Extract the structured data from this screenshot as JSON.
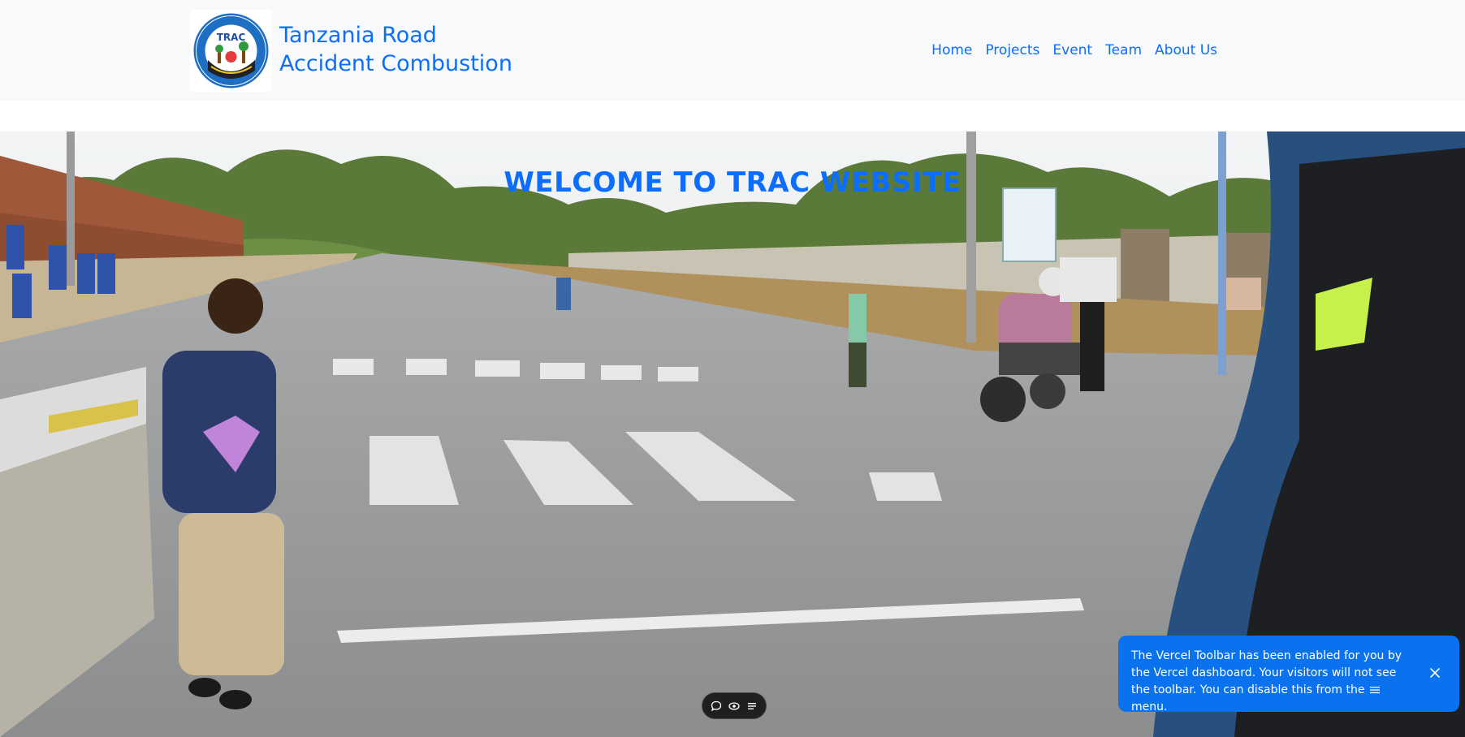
{
  "header": {
    "logo": {
      "text": "TRAC",
      "ring_text": "TANZANIA ROAD ACCIDENT COMBUSTION"
    },
    "brand_line1": "Tanzania Road",
    "brand_line2": "Accident Combustion",
    "nav": [
      "Home",
      "Projects",
      "Event",
      "Team",
      "About Us"
    ]
  },
  "hero": {
    "title": "WELCOME TO TRAC WEBSITE"
  },
  "vercel_toolbar": {
    "icons": [
      "comment-icon",
      "eye-icon",
      "menu-icon"
    ]
  },
  "toast": {
    "message_part1": "The Vercel Toolbar has been enabled for you by the Vercel dashboard. Your visitors will not see the toolbar. You can disable this from the",
    "message_part2": "menu."
  },
  "colors": {
    "brand_blue": "#0d6efd",
    "toast_blue": "#0a72ef",
    "header_bg": "#f8f9fa"
  }
}
